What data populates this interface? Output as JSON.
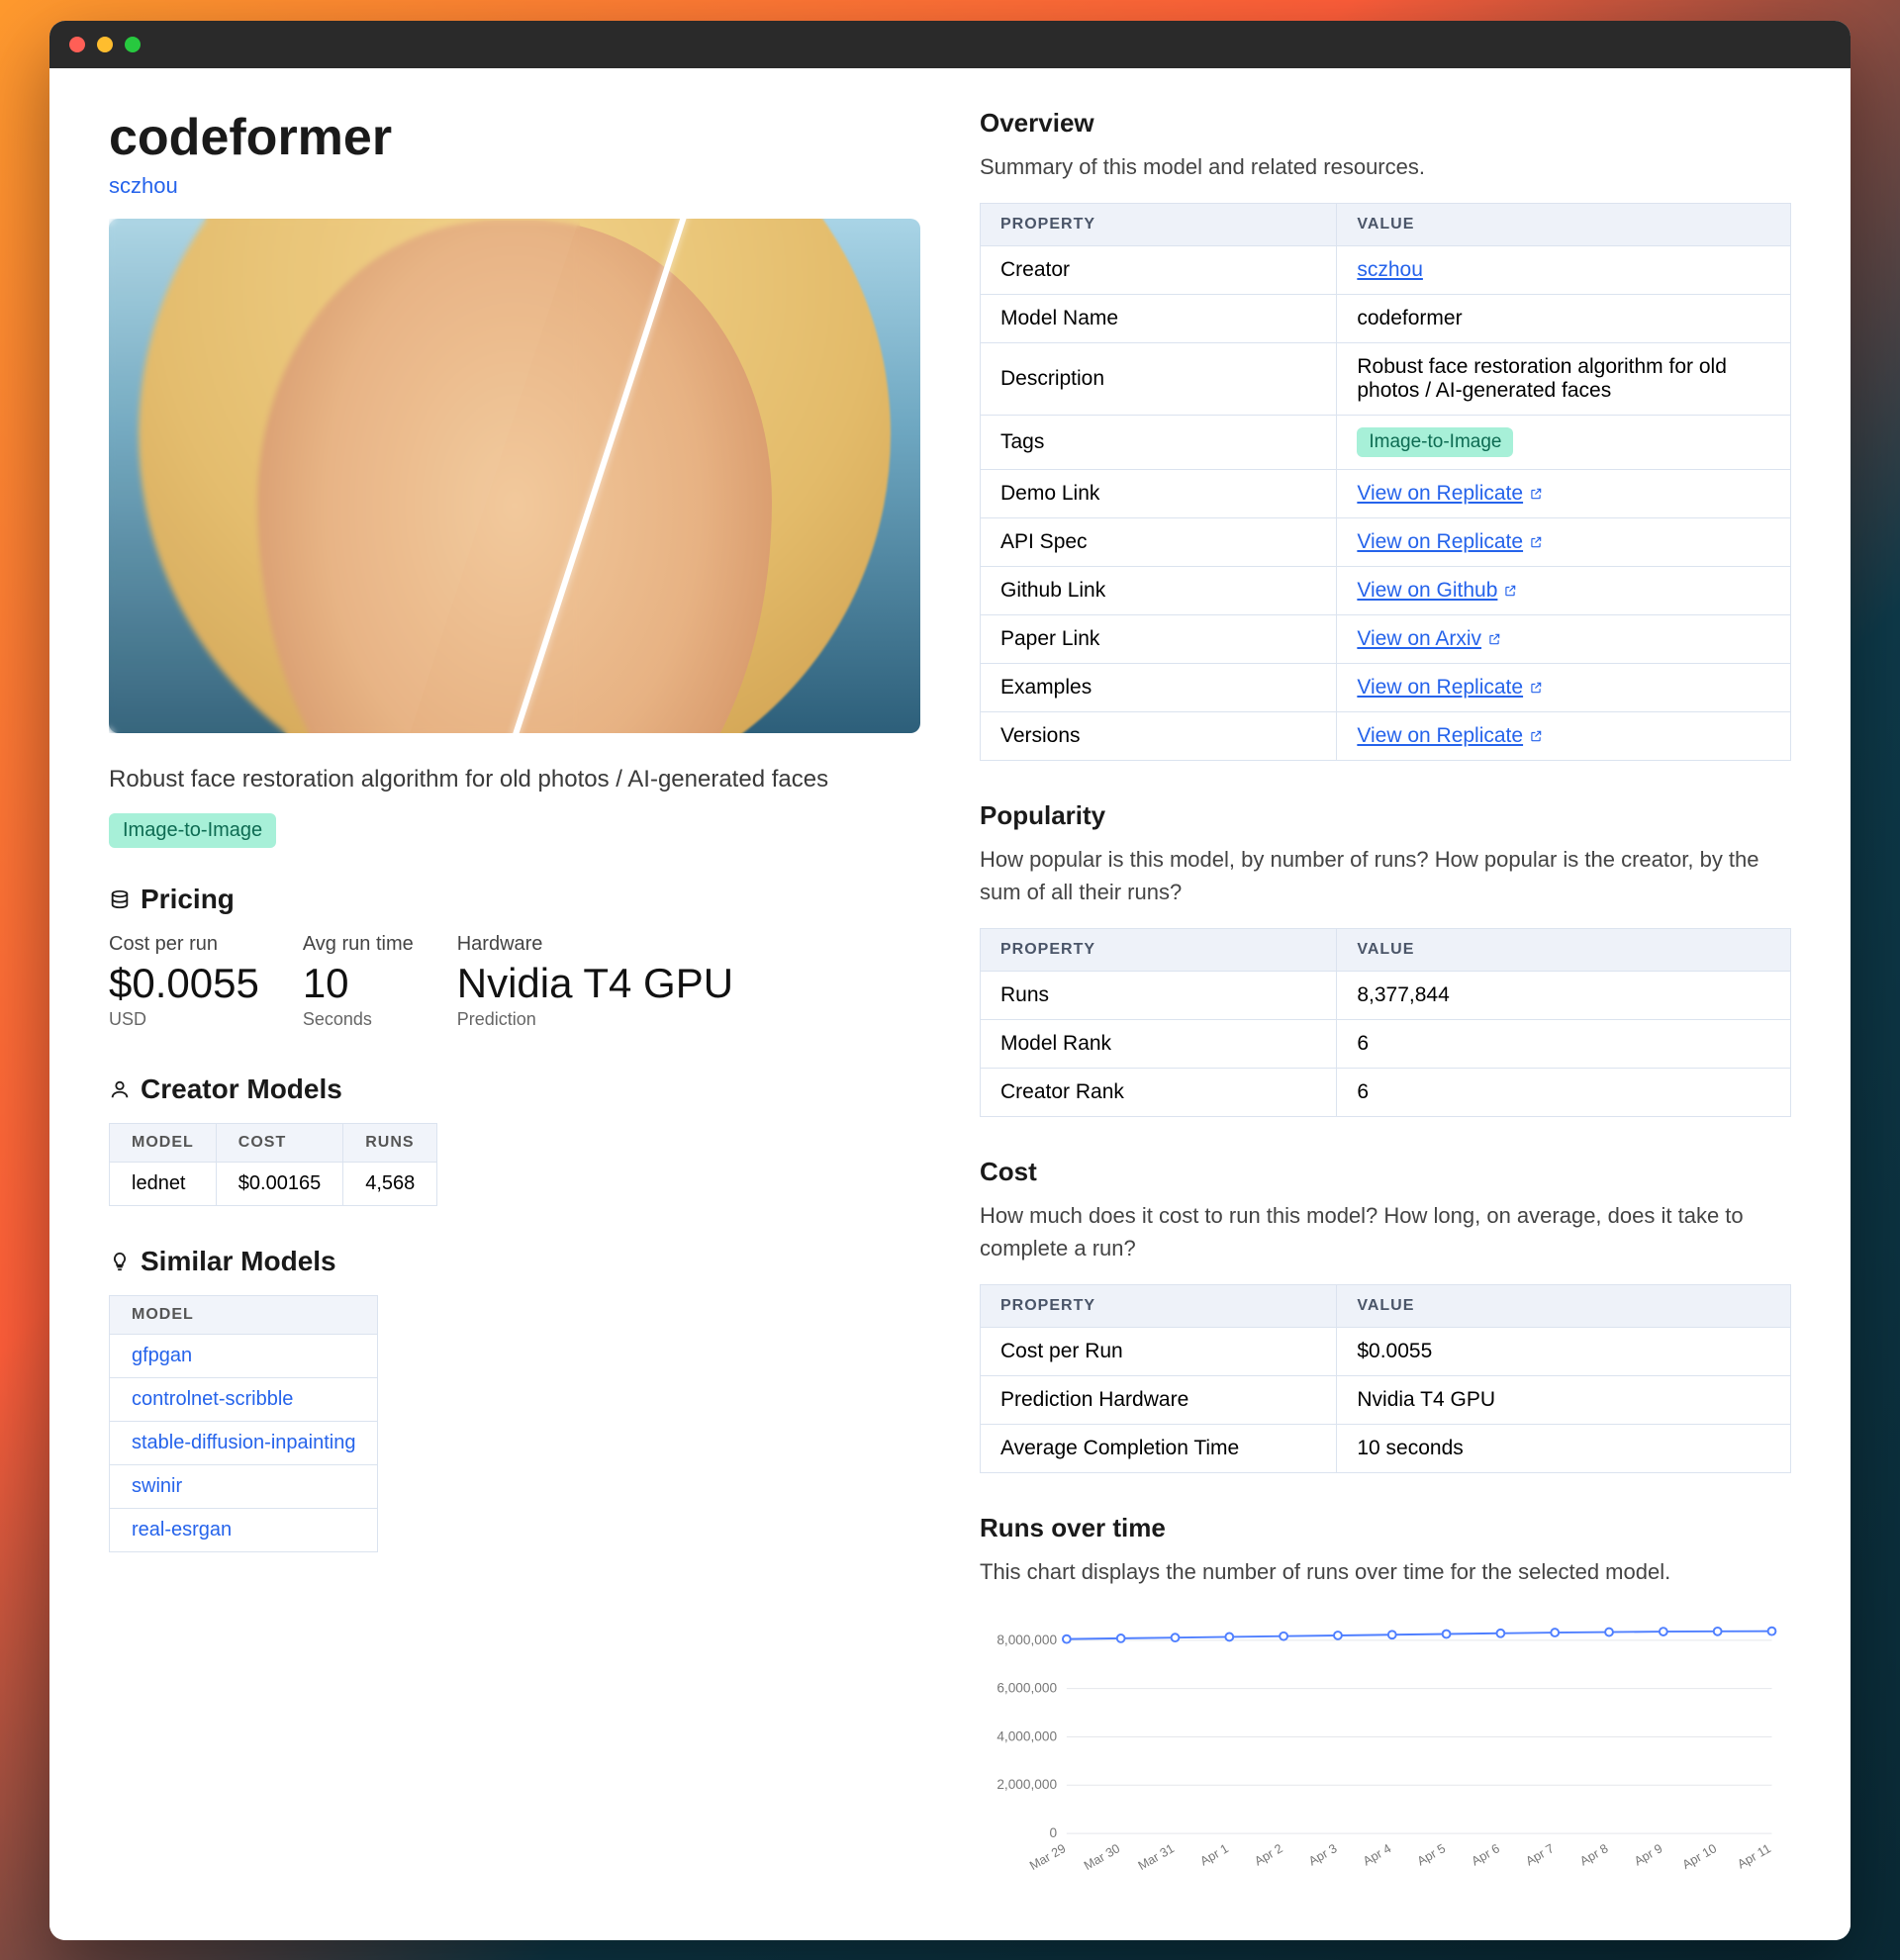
{
  "left": {
    "title": "codeformer",
    "creator": "sczhou",
    "description": "Robust face restoration algorithm for old photos / AI-generated faces",
    "tag": "Image-to-Image",
    "pricing_heading": "Pricing",
    "pricing": {
      "cost_label": "Cost per run",
      "cost_value": "$0.0055",
      "cost_unit": "USD",
      "time_label": "Avg run time",
      "time_value": "10",
      "time_unit": "Seconds",
      "hw_label": "Hardware",
      "hw_value": "Nvidia T4 GPU",
      "hw_unit": "Prediction"
    },
    "creator_models_heading": "Creator Models",
    "creator_models_headers": {
      "model": "MODEL",
      "cost": "COST",
      "runs": "RUNS"
    },
    "creator_models": [
      {
        "model": "lednet",
        "cost": "$0.00165",
        "runs": "4,568"
      }
    ],
    "similar_heading": "Similar Models",
    "similar_header": "MODEL",
    "similar_models": [
      "gfpgan",
      "controlnet-scribble",
      "stable-diffusion-inpainting",
      "swinir",
      "real-esrgan"
    ]
  },
  "right": {
    "overview_heading": "Overview",
    "overview_sub": "Summary of this model and related resources.",
    "prop_header": "PROPERTY",
    "val_header": "VALUE",
    "overview_rows": [
      {
        "prop": "Creator",
        "type": "link",
        "val": "sczhou"
      },
      {
        "prop": "Model Name",
        "type": "text",
        "val": "codeformer"
      },
      {
        "prop": "Description",
        "type": "text",
        "val": "Robust face restoration algorithm for old photos / AI-generated faces"
      },
      {
        "prop": "Tags",
        "type": "tag",
        "val": "Image-to-Image"
      },
      {
        "prop": "Demo Link",
        "type": "extlink",
        "val": "View on Replicate"
      },
      {
        "prop": "API Spec",
        "type": "extlink",
        "val": "View on Replicate"
      },
      {
        "prop": "Github Link",
        "type": "extlink",
        "val": "View on Github"
      },
      {
        "prop": "Paper Link",
        "type": "extlink",
        "val": "View on Arxiv"
      },
      {
        "prop": "Examples",
        "type": "extlink",
        "val": "View on Replicate"
      },
      {
        "prop": "Versions",
        "type": "extlink",
        "val": "View on Replicate"
      }
    ],
    "popularity_heading": "Popularity",
    "popularity_sub": "How popular is this model, by number of runs? How popular is the creator, by the sum of all their runs?",
    "popularity_rows": [
      {
        "prop": "Runs",
        "val": "8,377,844"
      },
      {
        "prop": "Model Rank",
        "val": "6"
      },
      {
        "prop": "Creator Rank",
        "val": "6"
      }
    ],
    "cost_heading": "Cost",
    "cost_sub": "How much does it cost to run this model? How long, on average, does it take to complete a run?",
    "cost_rows": [
      {
        "prop": "Cost per Run",
        "val": "$0.0055"
      },
      {
        "prop": "Prediction Hardware",
        "val": "Nvidia T4 GPU"
      },
      {
        "prop": "Average Completion Time",
        "val": "10 seconds"
      }
    ],
    "runs_heading": "Runs over time",
    "runs_sub": "This chart displays the number of runs over time for the selected model."
  },
  "chart_data": {
    "type": "line",
    "title": "",
    "xlabel": "",
    "ylabel": "",
    "ylim": [
      0,
      8000000
    ],
    "y_ticks": [
      0,
      2000000,
      4000000,
      6000000,
      8000000
    ],
    "y_tick_labels": [
      "0",
      "2,000,000",
      "4,000,000",
      "6,000,000",
      "8,000,000"
    ],
    "categories": [
      "Mar 29",
      "Mar 30",
      "Mar 31",
      "Apr 1",
      "Apr 2",
      "Apr 3",
      "Apr 4",
      "Apr 5",
      "Apr 6",
      "Apr 7",
      "Apr 8",
      "Apr 9",
      "Apr 10",
      "Apr 11"
    ],
    "series": [
      {
        "name": "runs",
        "values": [
          8050000,
          8080000,
          8110000,
          8140000,
          8170000,
          8200000,
          8230000,
          8260000,
          8290000,
          8320000,
          8340000,
          8360000,
          8370000,
          8377844
        ]
      }
    ]
  }
}
